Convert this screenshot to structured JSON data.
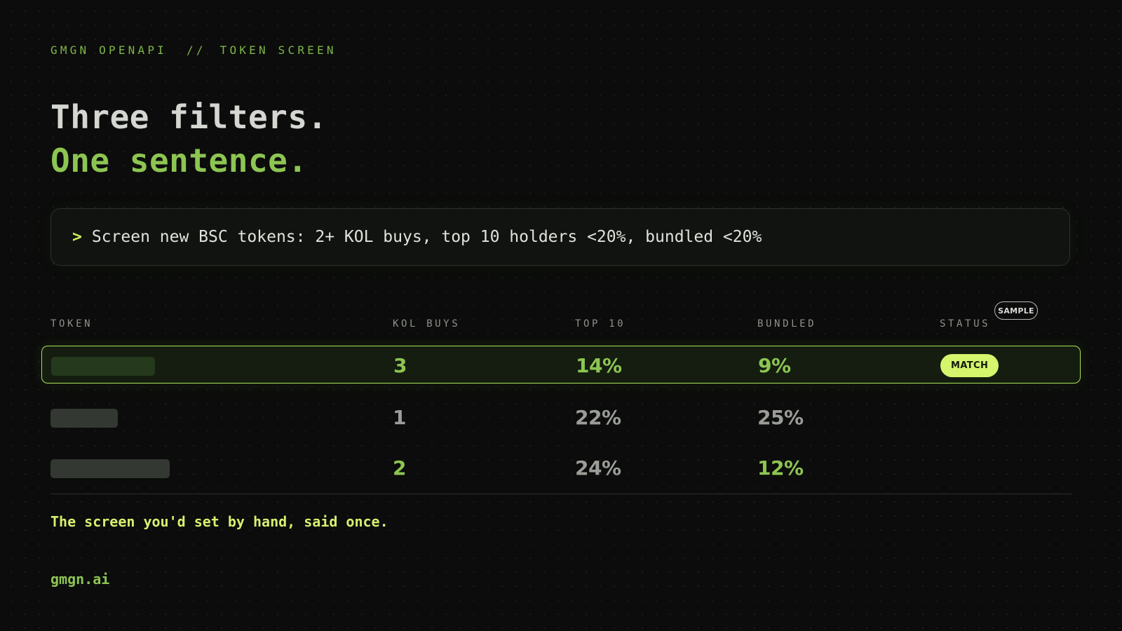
{
  "breadcrumb": {
    "section": "GMGN OPENAPI",
    "separator": "//",
    "page": "TOKEN SCREEN"
  },
  "headline": {
    "line1": "Three filters.",
    "line2": "One sentence."
  },
  "prompt": {
    "caret": ">",
    "text": "Screen new BSC tokens: 2+ KOL buys, top 10 holders <20%, bundled <20%"
  },
  "table": {
    "sample_badge": "SAMPLE",
    "columns": [
      "TOKEN",
      "KOL BUYS",
      "TOP 10",
      "BUNDLED",
      "STATUS"
    ],
    "rows": [
      {
        "kol_buys": "3",
        "top10": "14%",
        "bundled": "9%",
        "status": "MATCH"
      },
      {
        "kol_buys": "1",
        "top10": "22%",
        "bundled": "25%",
        "status": ""
      },
      {
        "kol_buys": "2",
        "top10": "24%",
        "bundled": "12%",
        "status": ""
      }
    ]
  },
  "tagline": "The screen you'd set by hand, said once.",
  "brand": "gmgn.ai",
  "colors": {
    "background": "#0b0c0b",
    "accent_green": "#8dc552",
    "highlight_border": "#a8e05a",
    "match_badge": "#d4f56c",
    "muted": "#9b9e98"
  }
}
